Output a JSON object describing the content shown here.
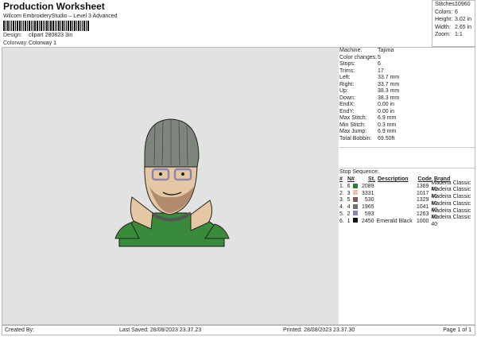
{
  "header": {
    "title": "Production Worksheet",
    "subtitle": "Wilcom EmbroideryStudio – Level 3 Advanced",
    "design_label": "Design:",
    "design_value": "clipart 280823 3in",
    "colorway_label": "Colorway:",
    "colorway_value": "Colorway 1"
  },
  "summary": [
    {
      "label": "Stitches:",
      "value": "10960"
    },
    {
      "label": "Colors:",
      "value": "6"
    },
    {
      "label": "Height:",
      "value": "3.02 in"
    },
    {
      "label": "Width:",
      "value": "2.65 in"
    },
    {
      "label": "Zoom:",
      "value": "1:1"
    }
  ],
  "details": [
    {
      "label": "Machine:",
      "value": "Tajima"
    },
    {
      "label": "Color changes:",
      "value": "5"
    },
    {
      "label": "Stops:",
      "value": "6"
    },
    {
      "label": "Trims:",
      "value": "17"
    },
    {
      "label": "Left:",
      "value": "33.7 mm"
    },
    {
      "label": "Right:",
      "value": "33.7 mm"
    },
    {
      "label": "Up:",
      "value": "38.3 mm"
    },
    {
      "label": "Down:",
      "value": "38.3 mm"
    },
    {
      "label": "EndX:",
      "value": "0.00 in"
    },
    {
      "label": "EndY:",
      "value": "0.00 in"
    },
    {
      "label": "Max Stitch:",
      "value": "6.9 mm"
    },
    {
      "label": "Min Stitch:",
      "value": "0.3 mm"
    },
    {
      "label": "Max Jump:",
      "value": "6.9 mm"
    },
    {
      "label": "Total Bobbin:",
      "value": "69.50ft"
    }
  ],
  "stop_sequence": {
    "title": "Stop Sequence:",
    "headers": {
      "num": "#",
      "n": "N#",
      "st": "St.",
      "desc": "Description",
      "code": "Code",
      "brand": "Brand"
    },
    "rows": [
      {
        "num": "1.",
        "n": "6",
        "color": "#2f7d35",
        "st": "2089",
        "desc": "",
        "code": "1369",
        "brand": "Madeira Classic 40"
      },
      {
        "num": "2.",
        "n": "3",
        "color": "#efbfae",
        "st": "3331",
        "desc": "",
        "code": "1017",
        "brand": "Madeira Classic 40"
      },
      {
        "num": "3.",
        "n": "5",
        "color": "#7d5b52",
        "st": "530",
        "desc": "",
        "code": "1329",
        "brand": "Madeira Classic 40"
      },
      {
        "num": "4.",
        "n": "4",
        "color": "#6b7276",
        "st": "1965",
        "desc": "",
        "code": "1041",
        "brand": "Madeira Classic 40"
      },
      {
        "num": "5.",
        "n": "2",
        "color": "#8a86b3",
        "st": "593",
        "desc": "",
        "code": "1263",
        "brand": "Madeira Classic 40"
      },
      {
        "num": "6.",
        "n": "1",
        "color": "#111111",
        "st": "2450",
        "desc": "Emerald Black",
        "code": "1000",
        "brand": "Madeira Classic 40"
      }
    ]
  },
  "footer": {
    "created": "Created By:",
    "saved": "Last Saved: 28/08/2023 23.37.23",
    "printed": "Printed: 28/08/2023 23.37.30",
    "page": "Page 1 of 1"
  }
}
